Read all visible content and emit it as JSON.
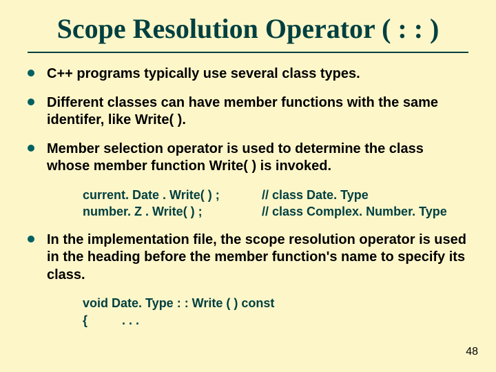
{
  "title": "Scope Resolution Operator ( : : )",
  "bullets": [
    "C++ programs typically use several class types.",
    "Different classes can have member functions with the same identifer, like Write( ).",
    "Member selection operator is used to determine the class whose member function Write( ) is invoked.",
    "In the implementation file, the scope resolution operator is used in the heading before the member function's name to specify its class."
  ],
  "code1": [
    {
      "left": "current. Date . Write( ) ;",
      "right": "// class Date. Type"
    },
    {
      "left": "number. Z . Write( ) ;",
      "right": "// class Complex. Number. Type"
    }
  ],
  "code2": [
    "void  Date. Type : : Write ( )   const",
    "{",
    ". . ."
  ],
  "page_number": "48"
}
